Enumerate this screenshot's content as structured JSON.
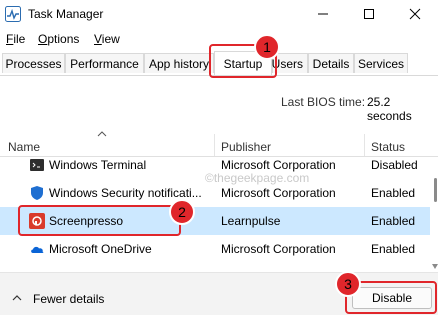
{
  "window": {
    "title": "Task Manager"
  },
  "menu": [
    {
      "label": "File",
      "underline": "F",
      "rest": "ile"
    },
    {
      "label": "Options",
      "underline": "O",
      "rest": "ptions"
    },
    {
      "label": "View",
      "underline": "V",
      "rest": "iew"
    }
  ],
  "tabs": [
    {
      "label": "Processes"
    },
    {
      "label": "Performance"
    },
    {
      "label": "App history"
    },
    {
      "label": "Startup"
    },
    {
      "label": "Users"
    },
    {
      "label": "Details"
    },
    {
      "label": "Services"
    }
  ],
  "bios": {
    "label": "Last BIOS time:",
    "value": "25.2 seconds"
  },
  "columns": {
    "name": "Name",
    "publisher": "Publisher",
    "status": "Status"
  },
  "rows": [
    {
      "name": "Windows Terminal",
      "publisher": "Microsoft Corporation",
      "status": "Disabled",
      "icon": "terminal-icon"
    },
    {
      "name": "Windows Security notificati...",
      "publisher": "Microsoft Corporation",
      "status": "Enabled",
      "icon": "shield-icon"
    },
    {
      "name": "Screenpresso",
      "publisher": "Learnpulse",
      "status": "Enabled",
      "icon": "screenpresso-icon"
    },
    {
      "name": "Microsoft OneDrive",
      "publisher": "Microsoft Corporation",
      "status": "Enabled",
      "icon": "cloud-icon"
    }
  ],
  "footer": {
    "fewer_details": "Fewer details",
    "disable": "Disable"
  },
  "annotations": {
    "badge1": "1",
    "badge2": "2",
    "badge3": "3",
    "watermark": "©thegeekpage.com"
  },
  "colors": {
    "selected_row": "#cce8ff",
    "annotation_red": "#e0262b"
  }
}
